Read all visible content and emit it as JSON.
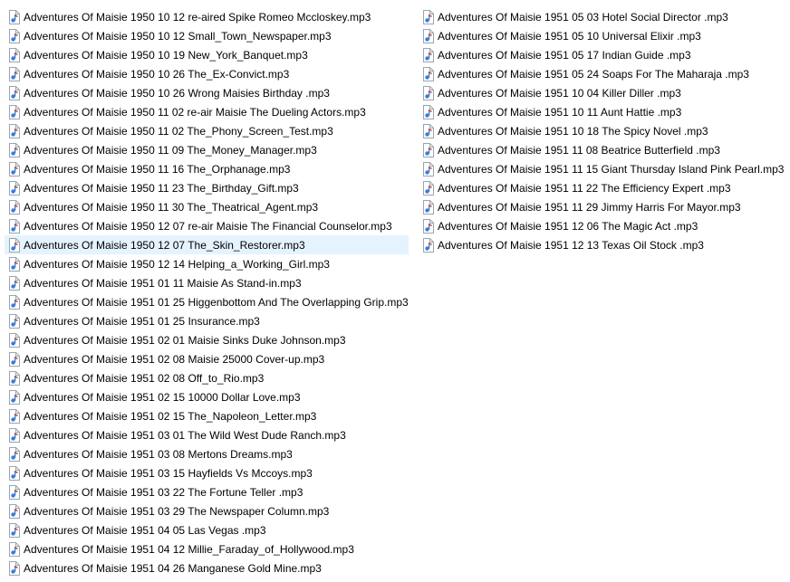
{
  "columns": [
    {
      "items": [
        {
          "name": "Adventures Of Maisie 1950 10 12 re-aired Spike Romeo Mccloskey.mp3"
        },
        {
          "name": "Adventures Of Maisie 1950 10 12 Small_Town_Newspaper.mp3"
        },
        {
          "name": "Adventures Of Maisie 1950 10 19 New_York_Banquet.mp3"
        },
        {
          "name": "Adventures Of Maisie 1950 10 26 The_Ex-Convict.mp3"
        },
        {
          "name": "Adventures Of Maisie 1950 10 26 Wrong Maisies Birthday .mp3"
        },
        {
          "name": "Adventures Of Maisie 1950 11 02 re-air Maisie The Dueling Actors.mp3"
        },
        {
          "name": "Adventures Of Maisie 1950 11 02 The_Phony_Screen_Test.mp3"
        },
        {
          "name": "Adventures Of Maisie 1950 11 09 The_Money_Manager.mp3"
        },
        {
          "name": "Adventures Of Maisie 1950 11 16 The_Orphanage.mp3"
        },
        {
          "name": "Adventures Of Maisie 1950 11 23 The_Birthday_Gift.mp3"
        },
        {
          "name": "Adventures Of Maisie 1950 11 30 The_Theatrical_Agent.mp3"
        },
        {
          "name": "Adventures Of Maisie 1950 12 07 re-air Maisie The Financial Counselor.mp3"
        },
        {
          "name": "Adventures Of Maisie 1950 12 07 The_Skin_Restorer.mp3",
          "selected": true
        },
        {
          "name": "Adventures Of Maisie 1950 12 14 Helping_a_Working_Girl.mp3"
        },
        {
          "name": "Adventures Of Maisie 1951 01 11 Maisie As Stand-in.mp3"
        },
        {
          "name": "Adventures Of Maisie 1951 01 25 Higgenbottom And The Overlapping Grip.mp3"
        },
        {
          "name": "Adventures Of Maisie 1951 01 25 Insurance.mp3"
        },
        {
          "name": "Adventures Of Maisie 1951 02 01 Maisie Sinks Duke Johnson.mp3"
        },
        {
          "name": "Adventures Of Maisie 1951 02 08 Maisie 25000 Cover-up.mp3"
        },
        {
          "name": "Adventures Of Maisie 1951 02 08 Off_to_Rio.mp3"
        },
        {
          "name": "Adventures Of Maisie 1951 02 15 10000 Dollar Love.mp3"
        },
        {
          "name": "Adventures Of Maisie 1951 02 15 The_Napoleon_Letter.mp3"
        },
        {
          "name": "Adventures Of Maisie 1951 03 01 The Wild West Dude Ranch.mp3"
        },
        {
          "name": "Adventures Of Maisie 1951 03 08 Mertons Dreams.mp3"
        },
        {
          "name": "Adventures Of Maisie 1951 03 15 Hayfields Vs Mccoys.mp3"
        },
        {
          "name": "Adventures Of Maisie 1951 03 22 The Fortune Teller .mp3"
        },
        {
          "name": "Adventures Of Maisie 1951 03 29 The Newspaper Column.mp3"
        },
        {
          "name": "Adventures Of Maisie 1951 04 05 Las Vegas .mp3"
        },
        {
          "name": "Adventures Of Maisie 1951 04 12 Millie_Faraday_of_Hollywood.mp3"
        },
        {
          "name": "Adventures Of Maisie 1951 04 26 Manganese Gold Mine.mp3"
        }
      ]
    },
    {
      "items": [
        {
          "name": "Adventures Of Maisie 1951 05 03 Hotel Social Director .mp3"
        },
        {
          "name": "Adventures Of Maisie 1951 05 10 Universal Elixir .mp3"
        },
        {
          "name": "Adventures Of Maisie 1951 05 17 Indian Guide .mp3"
        },
        {
          "name": "Adventures Of Maisie 1951 05 24 Soaps For The Maharaja .mp3"
        },
        {
          "name": "Adventures Of Maisie 1951 10 04 Killer Diller .mp3"
        },
        {
          "name": "Adventures Of Maisie 1951 10 11 Aunt Hattie .mp3"
        },
        {
          "name": "Adventures Of Maisie 1951 10 18 The Spicy Novel .mp3"
        },
        {
          "name": "Adventures Of Maisie 1951 11 08 Beatrice Butterfield .mp3"
        },
        {
          "name": "Adventures Of Maisie 1951 11 15 Giant Thursday Island Pink Pearl.mp3"
        },
        {
          "name": "Adventures Of Maisie 1951 11 22 The Efficiency Expert .mp3"
        },
        {
          "name": "Adventures Of Maisie 1951 11 29 Jimmy Harris For Mayor.mp3"
        },
        {
          "name": "Adventures Of Maisie 1951 12 06 The Magic Act .mp3"
        },
        {
          "name": "Adventures Of Maisie 1951 12 13 Texas Oil Stock .mp3"
        }
      ]
    }
  ],
  "icon": "audio-file-icon",
  "colors": {
    "selection": "#e5f3ff",
    "icon_page": "#ffffff",
    "icon_outline": "#9aa4b2",
    "icon_note": "#3b7bd4",
    "icon_accent": "#c0392b"
  }
}
